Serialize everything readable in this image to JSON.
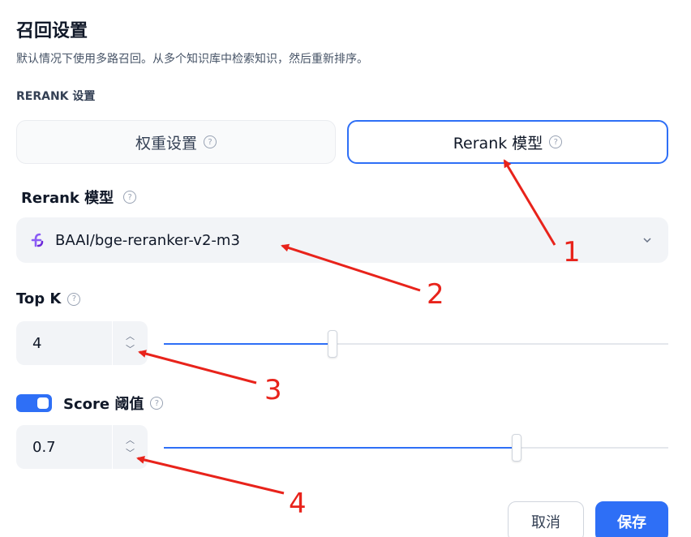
{
  "header": {
    "title": "召回设置",
    "subtitle": "默认情况下使用多路召回。从多个知识库中检索知识，然后重新排序。"
  },
  "rerank_section": {
    "label": "RERANK 设置",
    "tabs": [
      {
        "label": "权重设置",
        "selected": false
      },
      {
        "label": "Rerank 模型",
        "selected": true
      }
    ]
  },
  "rerank_model": {
    "label": "Rerank 模型",
    "value": "BAAI/bge-reranker-v2-m3",
    "icon": "model-provider-icon"
  },
  "top_k": {
    "label": "Top K",
    "value": "4",
    "slider_fraction": 0.335
  },
  "score_threshold": {
    "label": "Score 阈值",
    "enabled": true,
    "value": "0.7",
    "slider_fraction": 0.7
  },
  "footer": {
    "cancel_label": "取消",
    "save_label": "保存"
  },
  "annotations": [
    "1",
    "2",
    "3",
    "4"
  ],
  "colors": {
    "accent": "#2e6ff6",
    "annotation": "#e8231b",
    "model_icon": "#8b5cf6"
  }
}
